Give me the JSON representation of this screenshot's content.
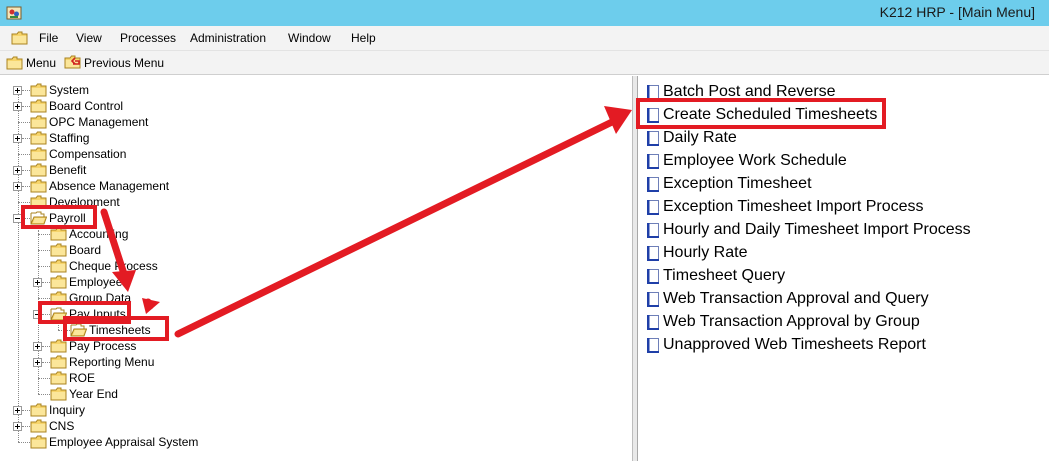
{
  "window": {
    "title": "K212 HRP - [Main Menu]"
  },
  "menubar": {
    "items": [
      "File",
      "View",
      "Processes",
      "Administration",
      "Window",
      "Help"
    ]
  },
  "toolbar": {
    "menu_label": "Menu",
    "previous_label": "Previous Menu"
  },
  "tree": {
    "nodes": [
      {
        "label": "System",
        "expander": "plus"
      },
      {
        "label": "Board Control",
        "expander": "plus"
      },
      {
        "label": "OPC Management",
        "expander": "none"
      },
      {
        "label": "Staffing",
        "expander": "plus"
      },
      {
        "label": "Compensation",
        "expander": "none"
      },
      {
        "label": "Benefit",
        "expander": "plus"
      },
      {
        "label": "Absence Management",
        "expander": "plus"
      },
      {
        "label": "Development",
        "expander": "none"
      },
      {
        "label": "Payroll",
        "expander": "minus"
      },
      {
        "label": "Accounting",
        "expander": "none"
      },
      {
        "label": "Board",
        "expander": "none"
      },
      {
        "label": "Cheque Process",
        "expander": "none"
      },
      {
        "label": "Employee",
        "expander": "plus"
      },
      {
        "label": "Group Data",
        "expander": "none"
      },
      {
        "label": "Pay Inputs",
        "expander": "minus"
      },
      {
        "label": "Timesheets",
        "expander": "none"
      },
      {
        "label": "Pay Process",
        "expander": "plus"
      },
      {
        "label": "Reporting Menu",
        "expander": "plus"
      },
      {
        "label": "ROE",
        "expander": "none"
      },
      {
        "label": "Year End",
        "expander": "none"
      },
      {
        "label": "Inquiry",
        "expander": "plus"
      },
      {
        "label": "CNS",
        "expander": "plus"
      },
      {
        "label": "Employee Appraisal System",
        "expander": "none"
      }
    ]
  },
  "list": {
    "items": [
      "Batch Post and Reverse",
      "Create Scheduled Timesheets",
      "Daily Rate",
      "Employee Work Schedule",
      "Exception Timesheet",
      "Exception Timesheet Import Process",
      "Hourly and Daily Timesheet Import Process",
      "Hourly Rate",
      "Timesheet Query",
      "Web Transaction Approval and Query",
      "Web Transaction Approval by Group",
      "Unapproved Web Timesheets Report"
    ],
    "selected": "Create Scheduled Timesheets"
  },
  "colors": {
    "titlebar": "#6dcdec",
    "annotation_red": "#e31b23",
    "folder_yellow": "#f6d46b",
    "doc_blue": "#1f3fa8"
  },
  "icons": {
    "app": "app-logo-icon",
    "folder": "folder-icon",
    "open_folder": "open-folder-icon",
    "document": "document-icon"
  }
}
